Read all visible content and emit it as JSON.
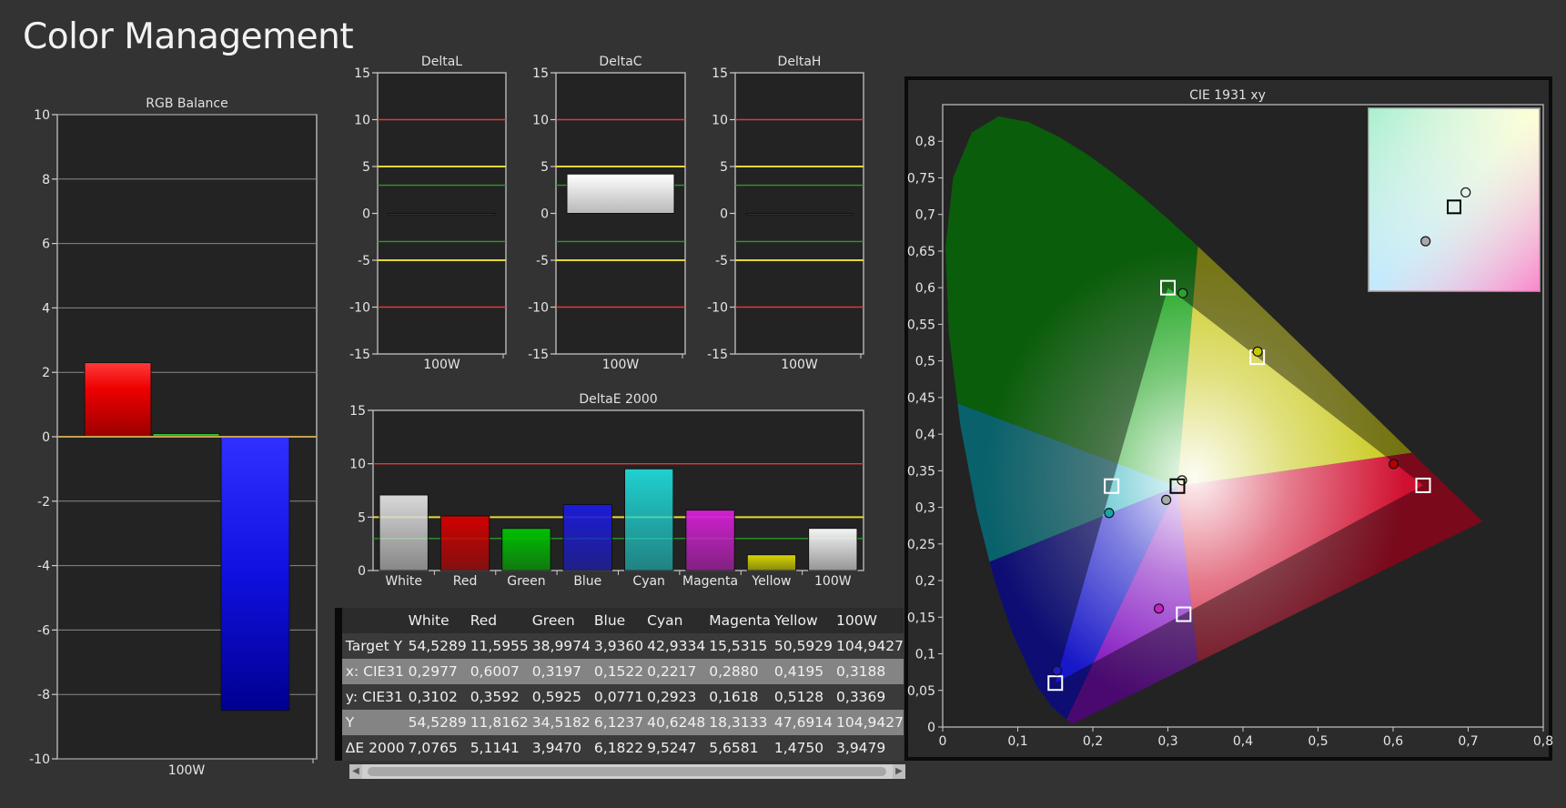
{
  "page": {
    "title": "Color Management"
  },
  "colors": {
    "red_line": "#e03a3a",
    "yellow_line": "#e6d83a",
    "green_line": "#2a9a2a",
    "plot_bg": "#232323",
    "panel_bg": "#333333"
  },
  "chart_data": [
    {
      "id": "rgb",
      "type": "bar",
      "title": "RGB Balance",
      "categories": [
        "100W"
      ],
      "series": [
        {
          "color": "red",
          "values": [
            2.3
          ]
        },
        {
          "color": "green",
          "values": [
            0.1
          ]
        },
        {
          "color": "blue",
          "values": [
            -8.5
          ]
        }
      ],
      "ylim": [
        -10,
        10
      ],
      "yticks": [
        "10",
        "8",
        "6",
        "4",
        "2",
        "0",
        "-2",
        "-4",
        "-6",
        "-8",
        "-10"
      ],
      "grid": true
    },
    {
      "id": "dl",
      "type": "bar",
      "title": "DeltaL",
      "categories": [
        "100W"
      ],
      "values": [
        0
      ],
      "ylim": [
        -15,
        15
      ],
      "yticks": [
        "15",
        "10",
        "5",
        "0",
        "-5",
        "-10",
        "-15"
      ],
      "reference_lines": [
        10,
        5,
        3,
        -3,
        -5,
        -10
      ]
    },
    {
      "id": "dc",
      "type": "bar",
      "title": "DeltaC",
      "categories": [
        "100W"
      ],
      "values": [
        4.2
      ],
      "ylim": [
        -15,
        15
      ],
      "yticks": [
        "15",
        "10",
        "5",
        "0",
        "-5",
        "-10",
        "-15"
      ],
      "reference_lines": [
        10,
        5,
        3,
        -3,
        -5,
        -10
      ]
    },
    {
      "id": "dh",
      "type": "bar",
      "title": "DeltaH",
      "categories": [
        "100W"
      ],
      "values": [
        0
      ],
      "ylim": [
        -15,
        15
      ],
      "yticks": [
        "15",
        "10",
        "5",
        "0",
        "-5",
        "-10",
        "-15"
      ],
      "reference_lines": [
        10,
        5,
        3,
        -3,
        -5,
        -10
      ]
    },
    {
      "id": "de",
      "type": "bar",
      "title": "DeltaE 2000",
      "categories": [
        "White",
        "Red",
        "Green",
        "Blue",
        "Cyan",
        "Magenta",
        "Yellow",
        "100W"
      ],
      "values": [
        7.0765,
        5.1141,
        3.947,
        6.1822,
        9.5247,
        5.6581,
        1.475,
        3.9479
      ],
      "bar_colors": [
        "#d8d8d8",
        "#d00000",
        "#00c000",
        "#1c1cd8",
        "#20d0d0",
        "#d020d0",
        "#d8d800",
        "#f4f4f4"
      ],
      "ylim": [
        0,
        15
      ],
      "yticks": [
        "15",
        "10",
        "5",
        "0"
      ],
      "reference_lines": [
        10,
        5,
        3
      ]
    },
    {
      "id": "cie",
      "type": "scatter",
      "title": "CIE 1931 xy",
      "xlim": [
        0,
        0.8
      ],
      "ylim": [
        0,
        0.85
      ],
      "xticks": [
        "0",
        "0,1",
        "0,2",
        "0,3",
        "0,4",
        "0,5",
        "0,6",
        "0,7",
        "0,8"
      ],
      "yticks": [
        "0",
        "0,05",
        "0,1",
        "0,15",
        "0,2",
        "0,25",
        "0,3",
        "0,35",
        "0,4",
        "0,45",
        "0,5",
        "0,55",
        "0,6",
        "0,65",
        "0,7",
        "0,75",
        "0,8"
      ],
      "targets": [
        {
          "name": "Red",
          "x": 0.64,
          "y": 0.33
        },
        {
          "name": "Green",
          "x": 0.3,
          "y": 0.6
        },
        {
          "name": "Blue",
          "x": 0.15,
          "y": 0.06
        },
        {
          "name": "Cyan",
          "x": 0.225,
          "y": 0.329
        },
        {
          "name": "Magenta",
          "x": 0.321,
          "y": 0.154
        },
        {
          "name": "Yellow",
          "x": 0.419,
          "y": 0.505
        },
        {
          "name": "White",
          "x": 0.3127,
          "y": 0.329
        }
      ],
      "measured": [
        {
          "name": "White",
          "x": 0.2977,
          "y": 0.3102,
          "fill": "#a9a9a9"
        },
        {
          "name": "Red",
          "x": 0.6007,
          "y": 0.3592,
          "fill": "#b40000"
        },
        {
          "name": "Green",
          "x": 0.3197,
          "y": 0.5925,
          "fill": "#2fa02f"
        },
        {
          "name": "Blue",
          "x": 0.1522,
          "y": 0.0771,
          "fill": "#1c1cc8"
        },
        {
          "name": "Cyan",
          "x": 0.2217,
          "y": 0.2923,
          "fill": "#17a8a8"
        },
        {
          "name": "Magenta",
          "x": 0.288,
          "y": 0.1618,
          "fill": "#c81fc8"
        },
        {
          "name": "Yellow",
          "x": 0.4195,
          "y": 0.5128,
          "fill": "#c8c800"
        },
        {
          "name": "100W",
          "x": 0.3188,
          "y": 0.3369,
          "fill": "none"
        }
      ],
      "inset": {
        "xlim": [
          0.2677,
          0.3577
        ],
        "ylim": [
          0.2829,
          0.3829
        ],
        "points": [
          {
            "kind": "target",
            "x": 0.3127,
            "y": 0.329
          },
          {
            "kind": "measured",
            "x": 0.3188,
            "y": 0.3369,
            "fill": "none"
          },
          {
            "kind": "measured",
            "x": 0.2977,
            "y": 0.3102,
            "fill": "#a9a9a9"
          }
        ]
      }
    }
  ],
  "table": {
    "header": [
      "",
      "White",
      "Red",
      "Green",
      "Blue",
      "Cyan",
      "Magenta",
      "Yellow",
      "100W"
    ],
    "rows": [
      [
        "Target Y",
        "54,5289",
        "11,5955",
        "38,9974",
        "3,9360",
        "42,9334",
        "15,5315",
        "50,5929",
        "104,9427"
      ],
      [
        "x: CIE31",
        "0,2977",
        "0,6007",
        "0,3197",
        "0,1522",
        "0,2217",
        "0,2880",
        "0,4195",
        "0,3188"
      ],
      [
        "y: CIE31",
        "0,3102",
        "0,3592",
        "0,5925",
        "0,0771",
        "0,2923",
        "0,1618",
        "0,5128",
        "0,3369"
      ],
      [
        "Y",
        "54,5289",
        "11,8162",
        "34,5182",
        "6,1237",
        "40,6248",
        "18,3133",
        "47,6914",
        "104,9427"
      ],
      [
        "ΔE 2000",
        "7,0765",
        "5,1141",
        "3,9470",
        "6,1822",
        "9,5247",
        "5,6581",
        "1,4750",
        "3,9479"
      ]
    ]
  }
}
